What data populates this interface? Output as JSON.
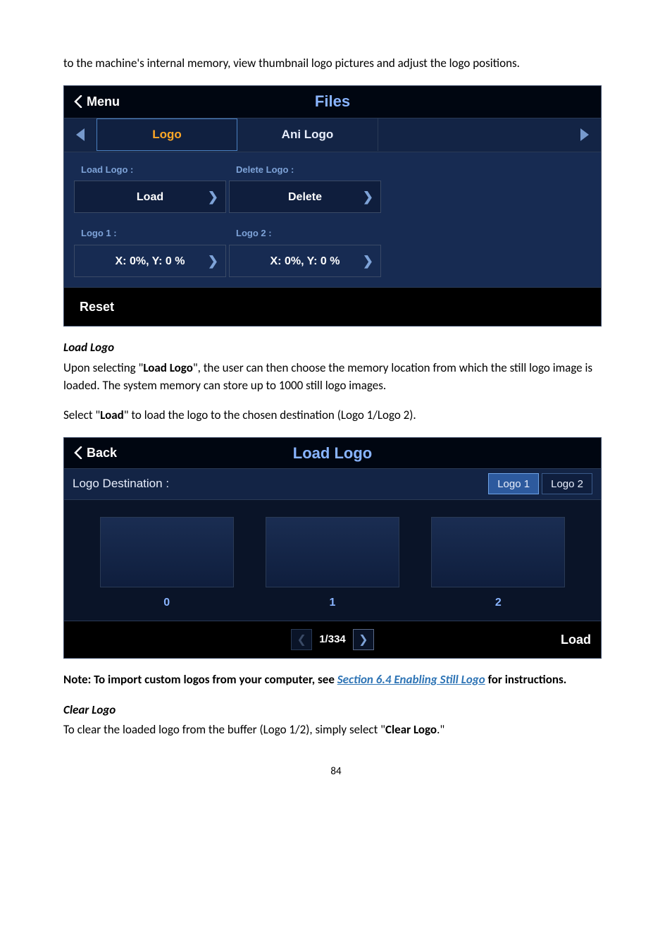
{
  "intro": "to the machine's internal memory, view thumbnail logo pictures and adjust the logo positions.",
  "s1": {
    "menu_label": "Menu",
    "title": "Files",
    "tab_logo": "Logo",
    "tab_ani": "Ani Logo",
    "load_logo_label": "Load Logo :",
    "delete_logo_label": "Delete Logo :",
    "load_btn": "Load",
    "delete_btn": "Delete",
    "logo1_label": "Logo 1 :",
    "logo2_label": "Logo 2 :",
    "logo1_val": "X: 0%, Y: 0 %",
    "logo2_val": "X: 0%, Y: 0 %",
    "reset": "Reset"
  },
  "sec_load_logo": {
    "heading": "Load Logo",
    "p1_a": "Upon selecting \"",
    "p1_b": "Load Logo",
    "p1_c": "\", the user can then choose the memory location from which the still logo image is loaded. The system memory can store up to 1000 still logo images.",
    "p2_a": "Select \"",
    "p2_b": "Load",
    "p2_c": "\" to load the logo to the chosen destination (Logo 1/Logo 2)."
  },
  "s2": {
    "back": "Back",
    "title": "Load Logo",
    "dest_label": "Logo Destination :",
    "logo1": "Logo 1",
    "logo2": "Logo 2",
    "cap0": "0",
    "cap1": "1",
    "cap2": "2",
    "pager": "1/334",
    "load": "Load"
  },
  "note_a": "Note: To import custom logos from your computer, see ",
  "note_link": "Section 6.4 Enabling Still Logo",
  "note_b": " for instructions.",
  "sec_clear": {
    "heading": "Clear Logo",
    "p_a": "To clear the loaded logo from the buffer (Logo 1/2), simply select \"",
    "p_b": "Clear Logo",
    "p_c": ".\""
  },
  "page_number": "84"
}
